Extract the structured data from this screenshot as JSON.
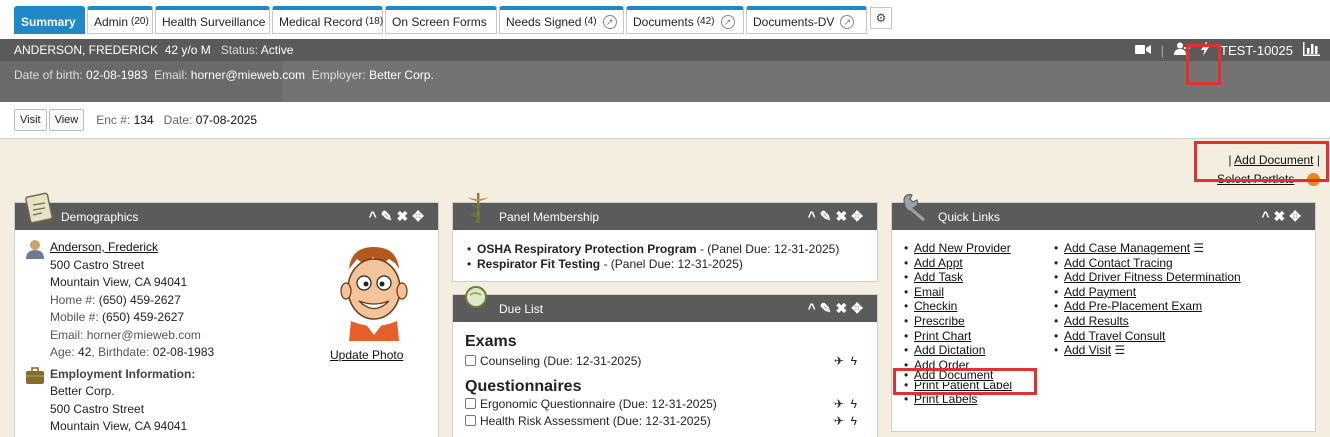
{
  "tabs": [
    {
      "label": "Summary",
      "count": "",
      "active": true
    },
    {
      "label": "Admin",
      "count": "(20)"
    },
    {
      "label": "Health Surveillance",
      "count": ""
    },
    {
      "label": "Medical Record",
      "count": "(18)"
    },
    {
      "label": "On Screen Forms",
      "count": ""
    },
    {
      "label": "Needs Signed",
      "count": "(4)"
    },
    {
      "label": "Documents",
      "count": "(42)"
    },
    {
      "label": "Documents-DV",
      "count": ""
    }
  ],
  "patient": {
    "name": "ANDERSON, FREDERICK",
    "age_sex": "42 y/o M",
    "status_label": "Status:",
    "status": "Active",
    "dob_label": "Date of birth:",
    "dob": "02-08-1983",
    "email_label": "Email:",
    "email": "horner@mieweb.com",
    "employer_label": "Employer:",
    "employer": "Better Corp.",
    "test_id": "TEST-10025"
  },
  "encounter": {
    "visit_btn": "Visit",
    "view_btn": "View",
    "enc_label": "Enc #:",
    "enc_no": "134",
    "date_label": "Date:",
    "date": "07-08-2025"
  },
  "portlet_links": {
    "pipe_left": "|",
    "add_document": "Add Document",
    "pipe_right": "|",
    "select_portlets": "Select Portlets"
  },
  "demographics": {
    "title": "Demographics",
    "name_link": "Anderson, Frederick",
    "street": "500 Castro Street",
    "city": "Mountain View, CA 94041",
    "home_label": "Home #:",
    "home": "(650) 459-2627",
    "mobile_label": "Mobile #:",
    "mobile": "(650) 459-2627",
    "email_label": "Email:",
    "email": "horner@mieweb.com",
    "age_label": "Age:",
    "age": "42",
    "birth_label": "Birthdate:",
    "birth": "02-08-1983",
    "update_photo": "Update Photo",
    "emp_title": "Employment Information:",
    "emp_name": "Better Corp.",
    "emp_street": "500 Castro Street",
    "emp_city": "Mountain View, CA 94041"
  },
  "panel": {
    "title": "Panel Membership",
    "items": [
      {
        "name": "OSHA Respiratory Protection Program",
        "due": " - (Panel Due: 12-31-2025)"
      },
      {
        "name": "Respirator Fit Testing",
        "due": " - (Panel Due: 12-31-2025)"
      }
    ]
  },
  "due": {
    "title": "Due List",
    "exams_heading": "Exams",
    "exam_items": [
      "Counseling (Due: 12-31-2025)"
    ],
    "quest_heading": "Questionnaires",
    "quest_items": [
      "Ergonomic Questionnaire (Due: 12-31-2025)",
      "Health Risk Assessment (Due: 12-31-2025)"
    ]
  },
  "quick": {
    "title": "Quick Links",
    "col1": [
      "Add New Provider",
      "Add Appt",
      "Add Task",
      "Email",
      "Checkin",
      "Prescribe",
      "Print Chart",
      "Add Dictation",
      "Add Order",
      "Add Document",
      "Print Patient Label",
      "Print Labels"
    ],
    "col2": [
      "Add Case Management",
      "Add Contact Tracing",
      "Add Driver Fitness Determination",
      "Add Payment",
      "Add Pre-Placement Exam",
      "Add Results",
      "Add Travel Consult",
      "Add Visit"
    ]
  }
}
